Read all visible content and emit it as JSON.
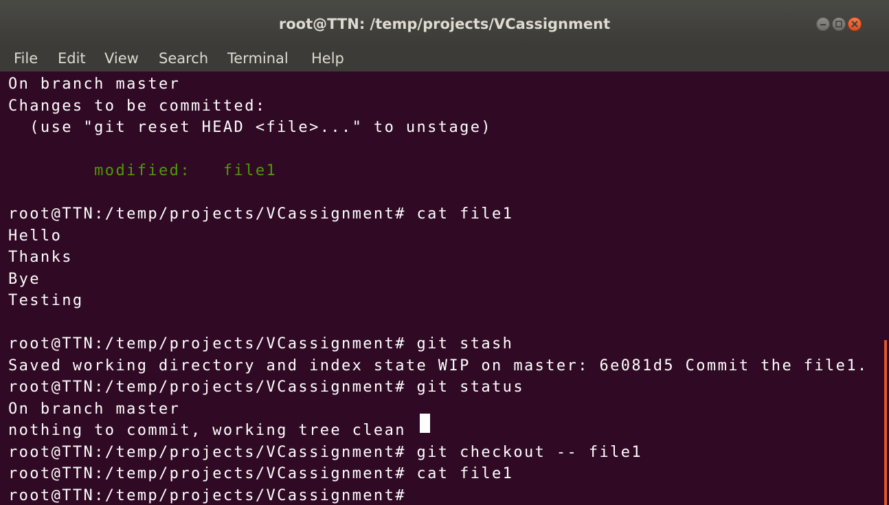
{
  "window": {
    "title": "root@TTN: /temp/projects/VCassignment",
    "controls": {
      "minimize_icon": "minimize-icon",
      "maximize_icon": "maximize-icon",
      "close_icon": "close-icon"
    }
  },
  "menubar": {
    "items": [
      "File",
      "Edit",
      "View",
      "Search",
      "Terminal",
      "Help"
    ]
  },
  "terminal": {
    "colors": {
      "background": "#300a24",
      "foreground": "#ffffff",
      "status_green": "#4e9a06",
      "scrollbar": "#e05a2b"
    },
    "lines": [
      "On branch master",
      "Changes to be committed:",
      "  (use \"git reset HEAD <file>...\" to unstage)",
      "",
      "        modified:   file1",
      "",
      "root@TTN:/temp/projects/VCassignment# cat file1",
      "Hello",
      "Thanks",
      "Bye",
      "Testing",
      "",
      "root@TTN:/temp/projects/VCassignment# git stash",
      "Saved working directory and index state WIP on master: 6e081d5 Commit the file1.",
      "root@TTN:/temp/projects/VCassignment# git status",
      "On branch master",
      "nothing to commit, working tree clean",
      "root@TTN:/temp/projects/VCassignment# git checkout -- file1",
      "root@TTN:/temp/projects/VCassignment# cat file1",
      "root@TTN:/temp/projects/VCassignment# "
    ]
  }
}
